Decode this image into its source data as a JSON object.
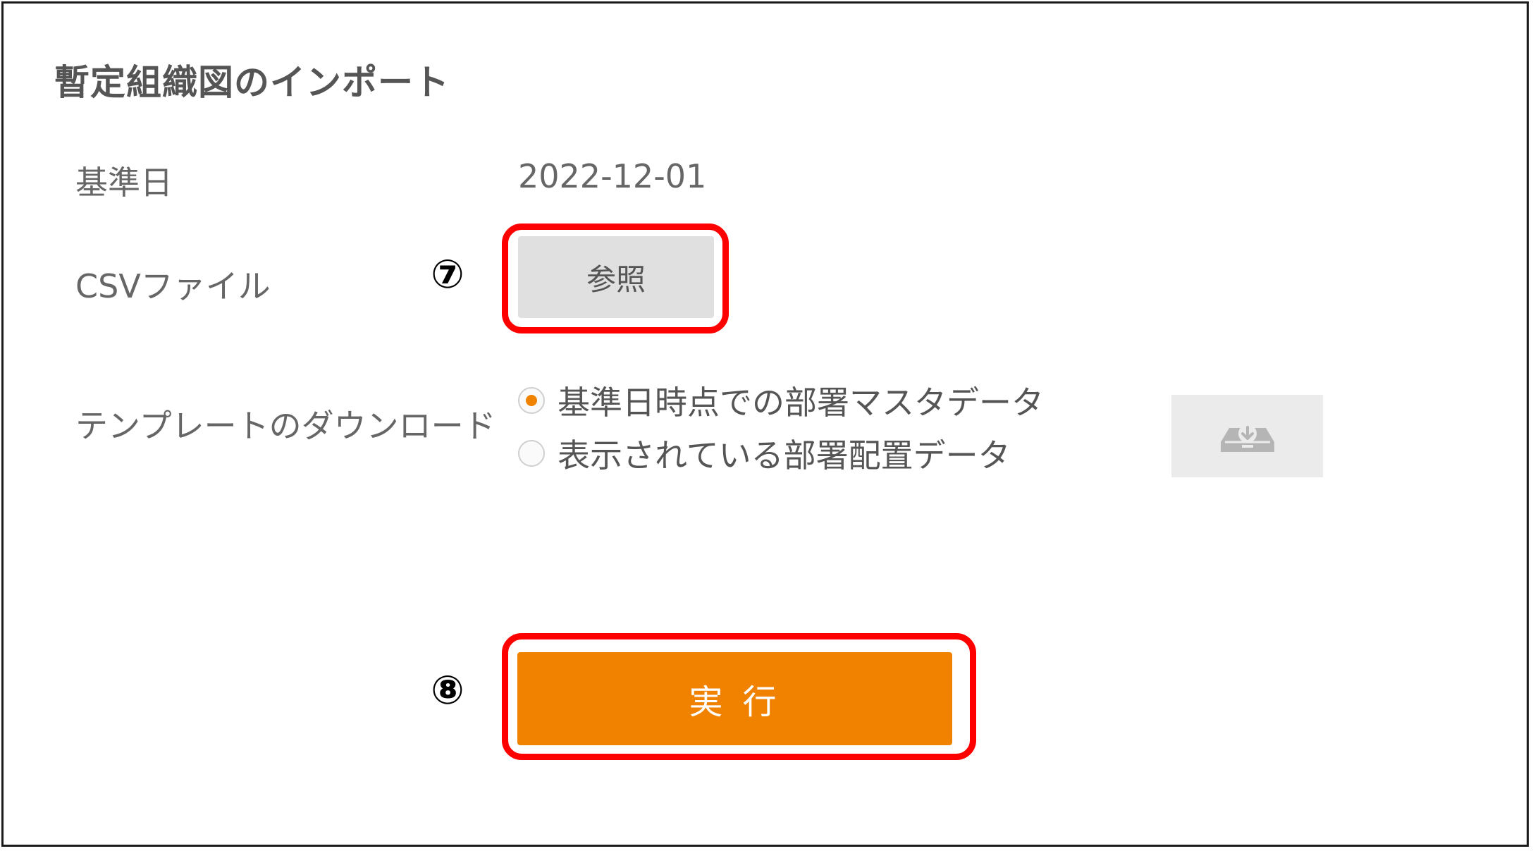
{
  "dialog": {
    "title": "暫定組織図のインポート"
  },
  "fields": {
    "base_date_label": "基準日",
    "base_date_value": "2022-12-01",
    "csv_label": "CSVファイル",
    "browse_label": "参照",
    "template_label": "テンプレートのダウンロード"
  },
  "template_options": [
    {
      "label": "基準日時点での部署マスタデータ",
      "selected": true
    },
    {
      "label": "表示されている部署配置データ",
      "selected": false
    }
  ],
  "download_icon": "tray-download-icon",
  "execute_label": "実行",
  "annotations": {
    "step7": "⑦",
    "step8": "⑧",
    "highlight_color": "#ff0000"
  },
  "colors": {
    "accent": "#f08200",
    "button_gray": "#e0e0e0"
  }
}
